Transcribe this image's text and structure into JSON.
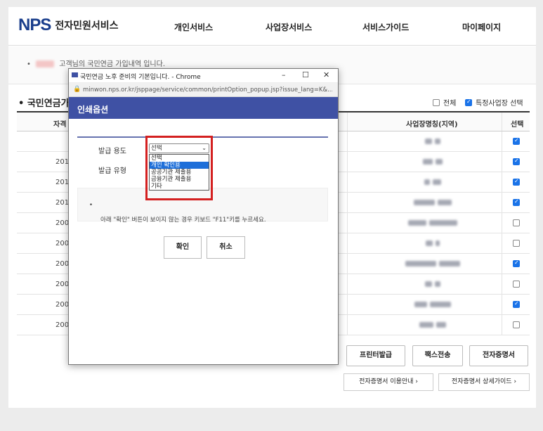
{
  "header": {
    "logo_mark": "NPS",
    "logo_text": "전자민원서비스",
    "nav": [
      "개인서비스",
      "사업장서비스",
      "서비스가이드",
      "마이페이지"
    ]
  },
  "banner": {
    "text": "고객님의 국민연금 가입내역 입니다."
  },
  "section": {
    "title": "국민연금가",
    "opt_all": "전체",
    "opt_specific": "특정사업장 선택"
  },
  "table": {
    "headers": [
      "자격",
      "사업장명칭(지역)",
      "선택"
    ],
    "years": [
      "",
      "201",
      "201",
      "201",
      "200",
      "200",
      "200",
      "200",
      "200",
      "200"
    ],
    "checked": [
      true,
      true,
      true,
      true,
      false,
      false,
      true,
      false,
      true,
      false
    ]
  },
  "buttons": {
    "printer": "프린터발급",
    "fax": "팩스전송",
    "ecert": "전자증명서",
    "ecert_info": "전자증명서 이용안내",
    "ecert_guide": "전자증명서 상세가이드"
  },
  "popup": {
    "window_title": "국민연금 노후 준비의 기본입니다. - Chrome",
    "url": "minwon.nps.or.kr/jsppage/service/common/printOption_popup.jsp?issue_lang=K&...",
    "heading": "인쇄옵션",
    "purpose_label": "발급 용도",
    "type_label": "발급 유형",
    "select_value": "선택",
    "options": [
      "선택",
      "개인 확인용",
      "공공기관 제출용",
      "금융기관 제출용",
      "기타"
    ],
    "selected_index": 1,
    "note": "아래 \"확인\" 버튼이 보이지 않는 경우 키보드 \"F11\"키를 누르세요.",
    "confirm": "확인",
    "cancel": "취소"
  },
  "colors": {
    "popup_header": "#3f51a4",
    "highlight": "#d42020",
    "accent": "#1e6fd9"
  }
}
